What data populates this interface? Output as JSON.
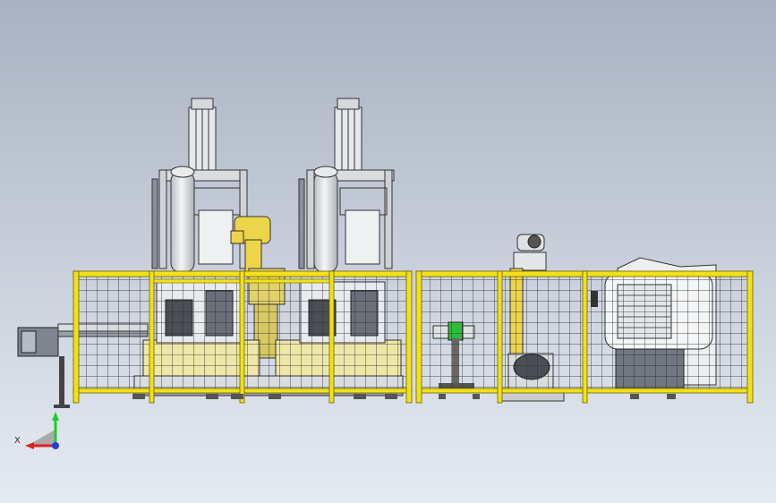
{
  "viewport": {
    "background_top": "#a9b2c2",
    "background_bottom": "#e6ebf2"
  },
  "colors": {
    "fence_yellow": "#f2e01a",
    "fence_mesh": "#2b2b2b",
    "robot_yellow": "#ecd54a",
    "base_yellow": "#efe7a8",
    "steel": "#d9dde0",
    "dark_steel": "#5a5f66",
    "green_accent": "#2dbb3b"
  },
  "triad": {
    "x_label": "X",
    "x_color": "#e01f1f",
    "y_color": "#1fcc2a",
    "z_color": "#1f3ee0",
    "icon": "coordinate-triad-icon"
  }
}
